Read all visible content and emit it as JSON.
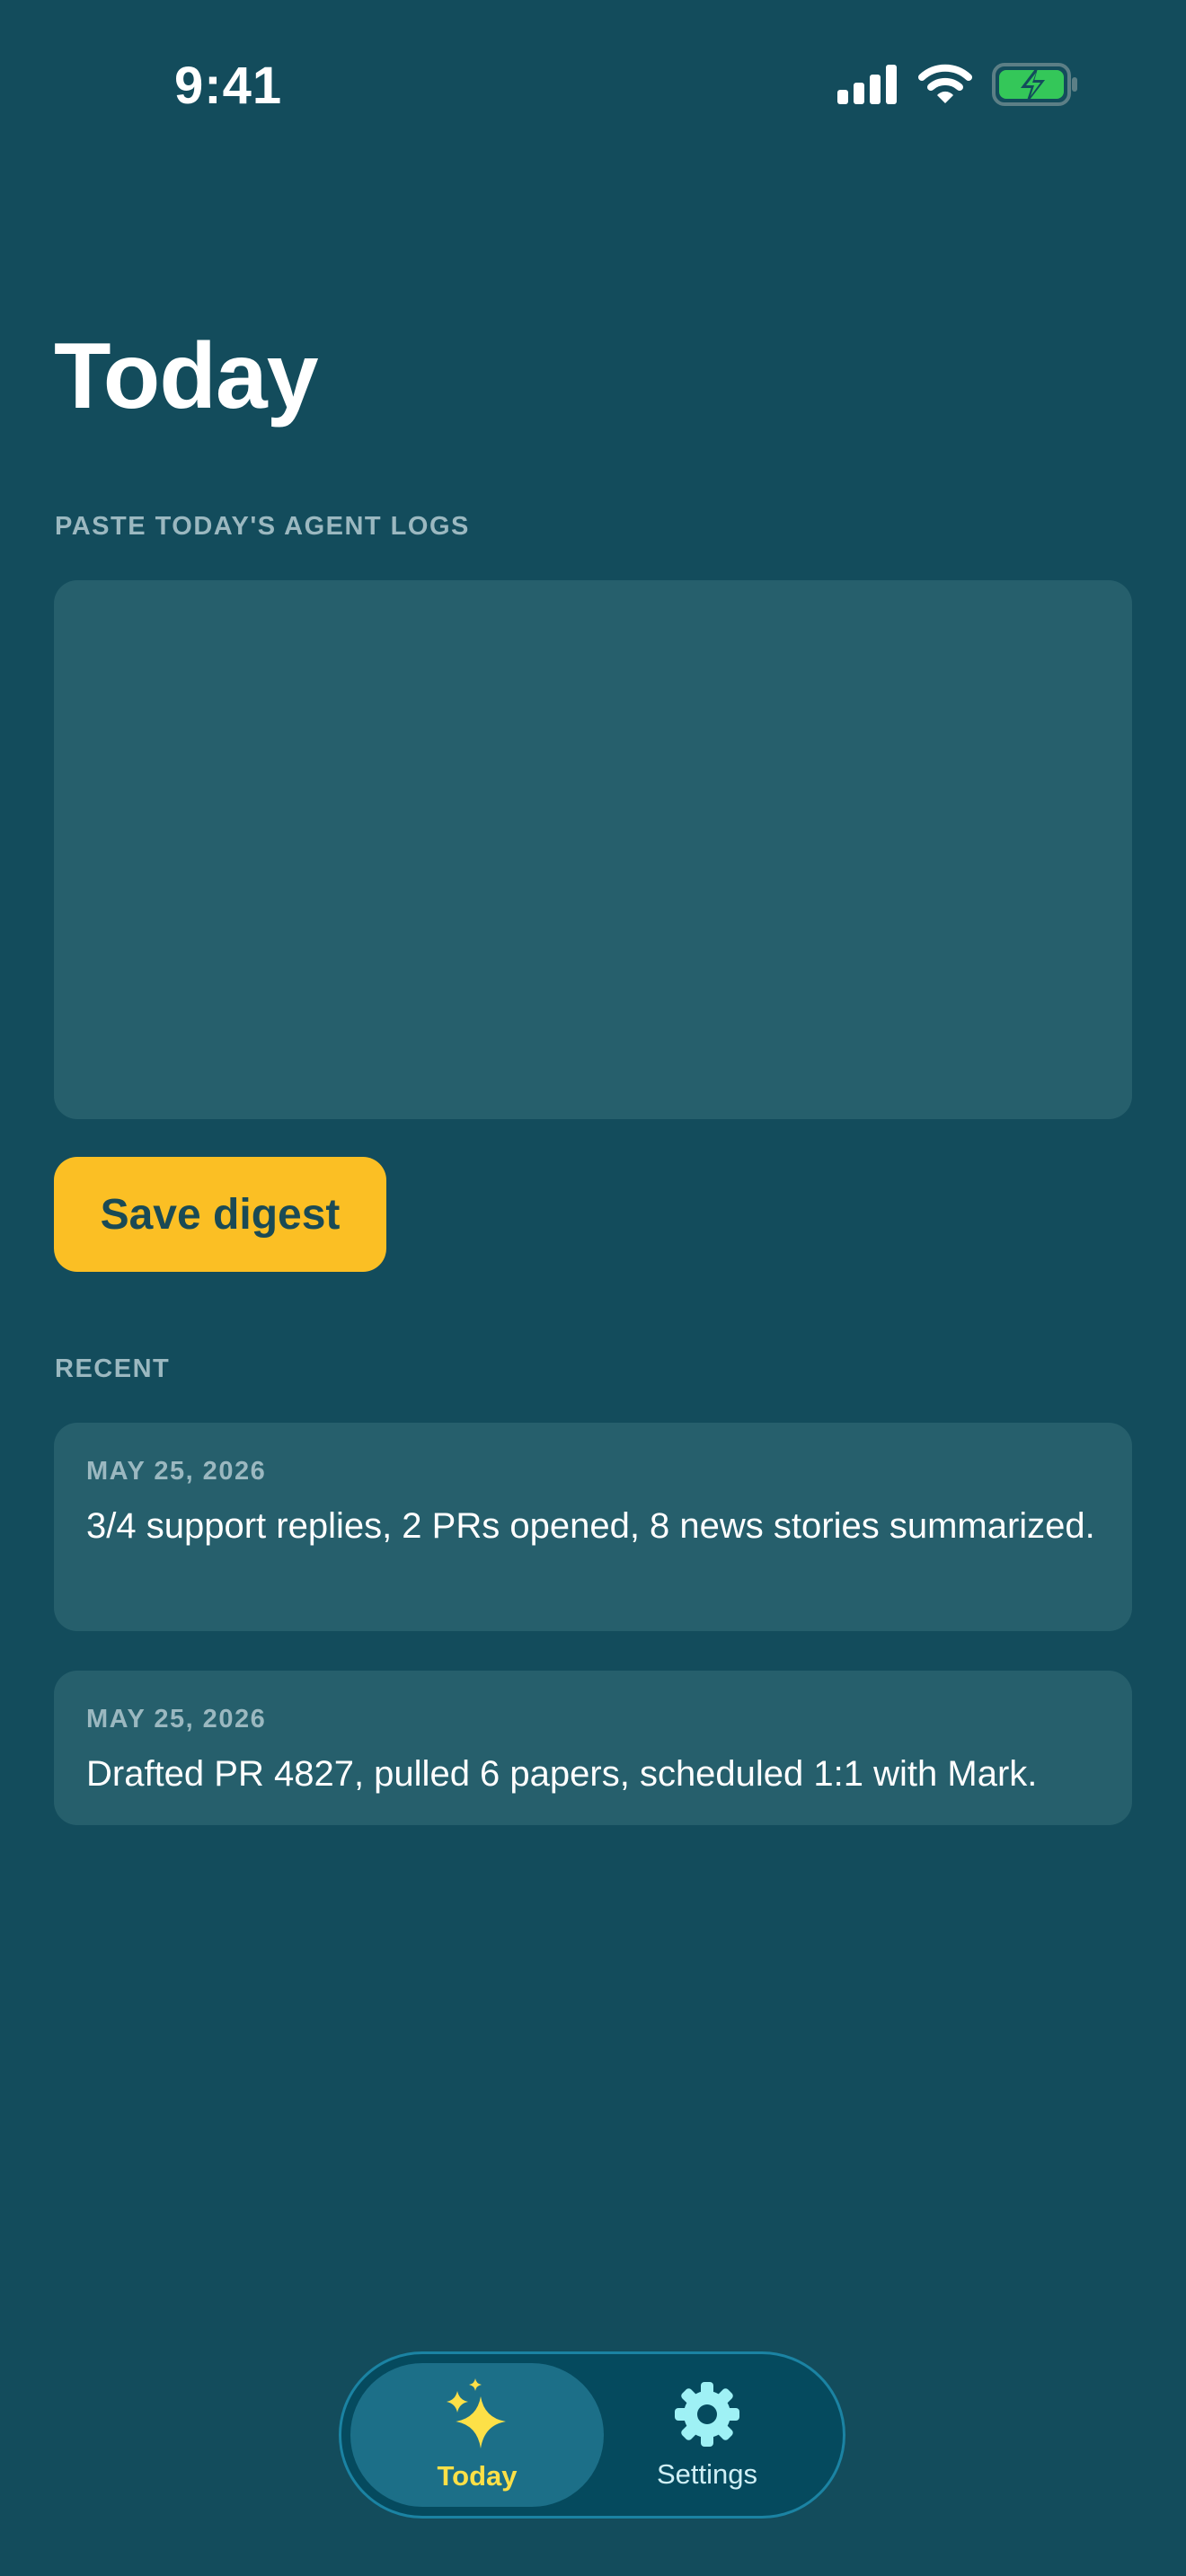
{
  "status_bar": {
    "time": "9:41",
    "icons": [
      "cellular-signal-icon",
      "wifi-icon",
      "battery-charging-icon"
    ]
  },
  "page": {
    "title": "Today"
  },
  "log_input": {
    "label": "PASTE TODAY'S AGENT LOGS",
    "value": "",
    "placeholder": ""
  },
  "save_button": {
    "label": "Save digest"
  },
  "recent": {
    "label": "RECENT",
    "items": [
      {
        "date": "MAY 25, 2026",
        "summary": "3/4 support replies, 2 PRs opened, 8 news stories summarized."
      },
      {
        "date": "MAY 25, 2026",
        "summary": "Drafted PR 4827, pulled 6 papers, scheduled 1:1 with Mark."
      }
    ]
  },
  "tab_bar": {
    "tabs": [
      {
        "label": "Today",
        "icon": "sparkles-icon",
        "selected": true
      },
      {
        "label": "Settings",
        "icon": "gear-icon",
        "selected": false
      }
    ]
  },
  "colors": {
    "background": "#134c5c",
    "surface": "#265f6c",
    "accent": "#fbbf24",
    "tab_selected": "#fde047",
    "muted_text": "#9bb8c0",
    "battery_fill": "#34c759"
  }
}
